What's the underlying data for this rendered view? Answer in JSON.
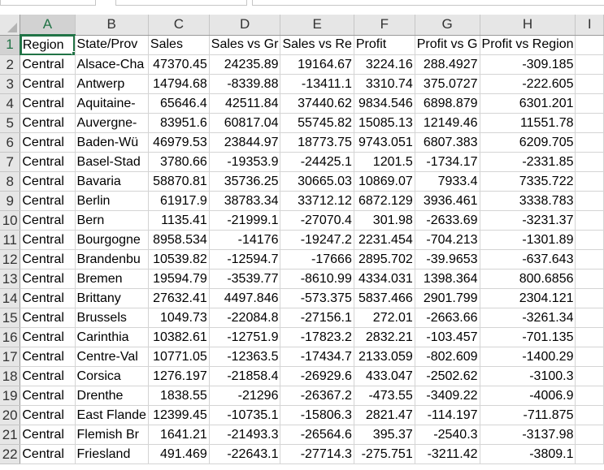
{
  "sheet": {
    "columns": [
      "A",
      "B",
      "C",
      "D",
      "E",
      "F",
      "G",
      "H",
      "I"
    ],
    "selected_column": "A",
    "active_cell": "A1",
    "rows": [
      {
        "n": "1",
        "cells": [
          "Region",
          "State/Prov",
          "Sales",
          "Sales vs Gr",
          "Sales vs Re",
          "Profit",
          "Profit vs G",
          "Profit vs Region",
          ""
        ]
      },
      {
        "n": "2",
        "cells": [
          "Central",
          "Alsace-Cha",
          "47370.45",
          "24235.89",
          "19164.67",
          "3224.16",
          "288.4927",
          "-309.185",
          ""
        ]
      },
      {
        "n": "3",
        "cells": [
          "Central",
          "Antwerp",
          "14794.68",
          "-8339.88",
          "-13411.1",
          "3310.74",
          "375.0727",
          "-222.605",
          ""
        ]
      },
      {
        "n": "4",
        "cells": [
          "Central",
          "Aquitaine-",
          "65646.4",
          "42511.84",
          "37440.62",
          "9834.546",
          "6898.879",
          "6301.201",
          ""
        ]
      },
      {
        "n": "5",
        "cells": [
          "Central",
          "Auvergne-",
          "83951.6",
          "60817.04",
          "55745.82",
          "15085.13",
          "12149.46",
          "11551.78",
          ""
        ]
      },
      {
        "n": "6",
        "cells": [
          "Central",
          "Baden-Wü",
          "46979.53",
          "23844.97",
          "18773.75",
          "9743.051",
          "6807.383",
          "6209.705",
          ""
        ]
      },
      {
        "n": "7",
        "cells": [
          "Central",
          "Basel-Stad",
          "3780.66",
          "-19353.9",
          "-24425.1",
          "1201.5",
          "-1734.17",
          "-2331.85",
          ""
        ]
      },
      {
        "n": "8",
        "cells": [
          "Central",
          "Bavaria",
          "58870.81",
          "35736.25",
          "30665.03",
          "10869.07",
          "7933.4",
          "7335.722",
          ""
        ]
      },
      {
        "n": "9",
        "cells": [
          "Central",
          "Berlin",
          "61917.9",
          "38783.34",
          "33712.12",
          "6872.129",
          "3936.461",
          "3338.783",
          ""
        ]
      },
      {
        "n": "10",
        "cells": [
          "Central",
          "Bern",
          "1135.41",
          "-21999.1",
          "-27070.4",
          "301.98",
          "-2633.69",
          "-3231.37",
          ""
        ]
      },
      {
        "n": "11",
        "cells": [
          "Central",
          "Bourgogne",
          "8958.534",
          "-14176",
          "-19247.2",
          "2231.454",
          "-704.213",
          "-1301.89",
          ""
        ]
      },
      {
        "n": "12",
        "cells": [
          "Central",
          "Brandenbu",
          "10539.82",
          "-12594.7",
          "-17666",
          "2895.702",
          "-39.9653",
          "-637.643",
          ""
        ]
      },
      {
        "n": "13",
        "cells": [
          "Central",
          "Bremen",
          "19594.79",
          "-3539.77",
          "-8610.99",
          "4334.031",
          "1398.364",
          "800.6856",
          ""
        ]
      },
      {
        "n": "14",
        "cells": [
          "Central",
          "Brittany",
          "27632.41",
          "4497.846",
          "-573.375",
          "5837.466",
          "2901.799",
          "2304.121",
          ""
        ]
      },
      {
        "n": "15",
        "cells": [
          "Central",
          "Brussels",
          "1049.73",
          "-22084.8",
          "-27156.1",
          "272.01",
          "-2663.66",
          "-3261.34",
          ""
        ]
      },
      {
        "n": "16",
        "cells": [
          "Central",
          "Carinthia",
          "10382.61",
          "-12751.9",
          "-17823.2",
          "2832.21",
          "-103.457",
          "-701.135",
          ""
        ]
      },
      {
        "n": "17",
        "cells": [
          "Central",
          "Centre-Val",
          "10771.05",
          "-12363.5",
          "-17434.7",
          "2133.059",
          "-802.609",
          "-1400.29",
          ""
        ]
      },
      {
        "n": "18",
        "cells": [
          "Central",
          "Corsica",
          "1276.197",
          "-21858.4",
          "-26929.6",
          "433.047",
          "-2502.62",
          "-3100.3",
          ""
        ]
      },
      {
        "n": "19",
        "cells": [
          "Central",
          "Drenthe",
          "1838.55",
          "-21296",
          "-26367.2",
          "-473.55",
          "-3409.22",
          "-4006.9",
          ""
        ]
      },
      {
        "n": "20",
        "cells": [
          "Central",
          "East Flande",
          "12399.45",
          "-10735.1",
          "-15806.3",
          "2821.47",
          "-114.197",
          "-711.875",
          ""
        ]
      },
      {
        "n": "21",
        "cells": [
          "Central",
          "Flemish Br",
          "1641.21",
          "-21493.3",
          "-26564.6",
          "395.37",
          "-2540.3",
          "-3137.98",
          ""
        ]
      },
      {
        "n": "22",
        "cells": [
          "Central",
          "Friesland",
          "491.469",
          "-22643.1",
          "-27714.3",
          "-275.751",
          "-3211.42",
          "-3809.1",
          ""
        ]
      }
    ]
  }
}
